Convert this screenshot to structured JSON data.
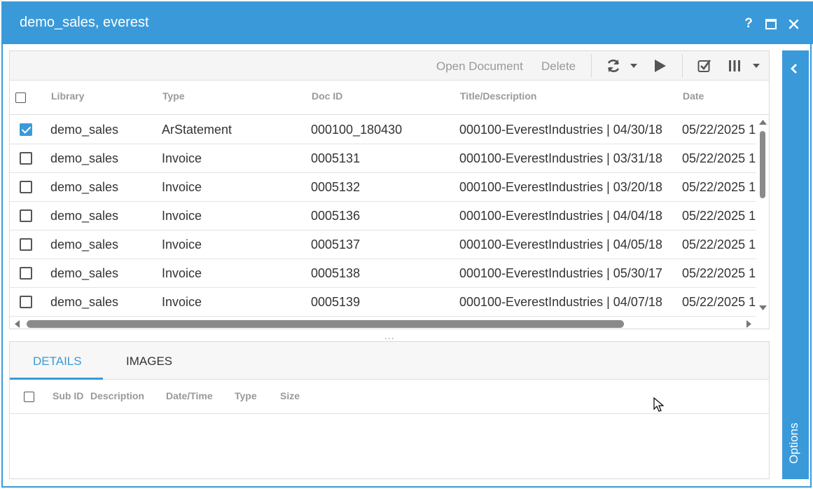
{
  "window": {
    "title": "demo_sales, everest",
    "help_label": "?",
    "accent_color": "#3a9ad9"
  },
  "toolbar": {
    "open_document": "Open Document",
    "delete": "Delete",
    "icons": [
      "refresh-icon",
      "caret-down-icon",
      "play-icon",
      "check-square-icon",
      "columns-icon",
      "caret-down-icon"
    ]
  },
  "grid": {
    "columns": [
      "Library",
      "Type",
      "Doc ID",
      "Title/Description",
      "Date"
    ],
    "rows": [
      {
        "checked": true,
        "library": "demo_sales",
        "type": "ArStatement",
        "doc_id": "000100_180430",
        "title": "000100-EverestIndustries | 04/30/18",
        "date": "05/22/2025 1"
      },
      {
        "checked": false,
        "library": "demo_sales",
        "type": "Invoice",
        "doc_id": "0005131",
        "title": "000100-EverestIndustries | 03/31/18",
        "date": "05/22/2025 1"
      },
      {
        "checked": false,
        "library": "demo_sales",
        "type": "Invoice",
        "doc_id": "0005132",
        "title": "000100-EverestIndustries | 03/20/18",
        "date": "05/22/2025 1"
      },
      {
        "checked": false,
        "library": "demo_sales",
        "type": "Invoice",
        "doc_id": "0005136",
        "title": "000100-EverestIndustries | 04/04/18",
        "date": "05/22/2025 1"
      },
      {
        "checked": false,
        "library": "demo_sales",
        "type": "Invoice",
        "doc_id": "0005137",
        "title": "000100-EverestIndustries | 04/05/18",
        "date": "05/22/2025 1"
      },
      {
        "checked": false,
        "library": "demo_sales",
        "type": "Invoice",
        "doc_id": "0005138",
        "title": "000100-EverestIndustries | 05/30/17",
        "date": "05/22/2025 1"
      },
      {
        "checked": false,
        "library": "demo_sales",
        "type": "Invoice",
        "doc_id": "0005139",
        "title": "000100-EverestIndustries | 04/07/18",
        "date": "05/22/2025 1"
      }
    ]
  },
  "splitter": "...",
  "details": {
    "tabs": [
      "DETAILS",
      "IMAGES"
    ],
    "active_tab": "DETAILS",
    "columns": [
      "Sub ID",
      "Description",
      "Date/Time",
      "Type",
      "Size"
    ]
  },
  "options": {
    "label": "Options"
  }
}
